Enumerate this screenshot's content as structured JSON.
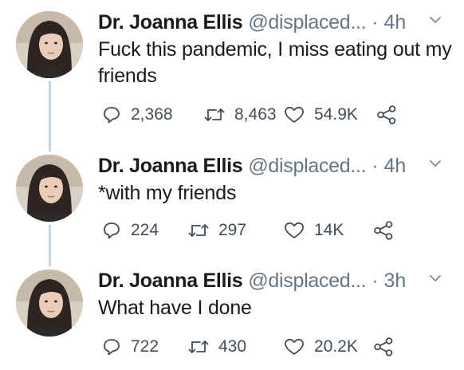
{
  "tweets": [
    {
      "name": "Dr. Joanna Ellis",
      "handle": "@displaced...",
      "dot": "·",
      "time": "4h",
      "text": "Fuck this pandemic, I miss eating out my friends",
      "replies": "2,368",
      "retweets": "8,463",
      "likes": "54.9K"
    },
    {
      "name": "Dr. Joanna Ellis",
      "handle": "@displaced...",
      "dot": "·",
      "time": "4h",
      "text": "*with my friends",
      "replies": "224",
      "retweets": "297",
      "likes": "14K"
    },
    {
      "name": "Dr. Joanna Ellis",
      "handle": "@displaced...",
      "dot": "·",
      "time": "3h",
      "text": "What have I done",
      "replies": "722",
      "retweets": "430",
      "likes": "20.2K"
    }
  ],
  "icons": {
    "reply": "reply-icon",
    "retweet": "retweet-icon",
    "like": "heart-icon",
    "share": "share-icon",
    "menu": "chevron-down-icon"
  },
  "colors": {
    "text": "#1a1a1a",
    "muted": "#657786",
    "connector": "#c9d1d9"
  }
}
